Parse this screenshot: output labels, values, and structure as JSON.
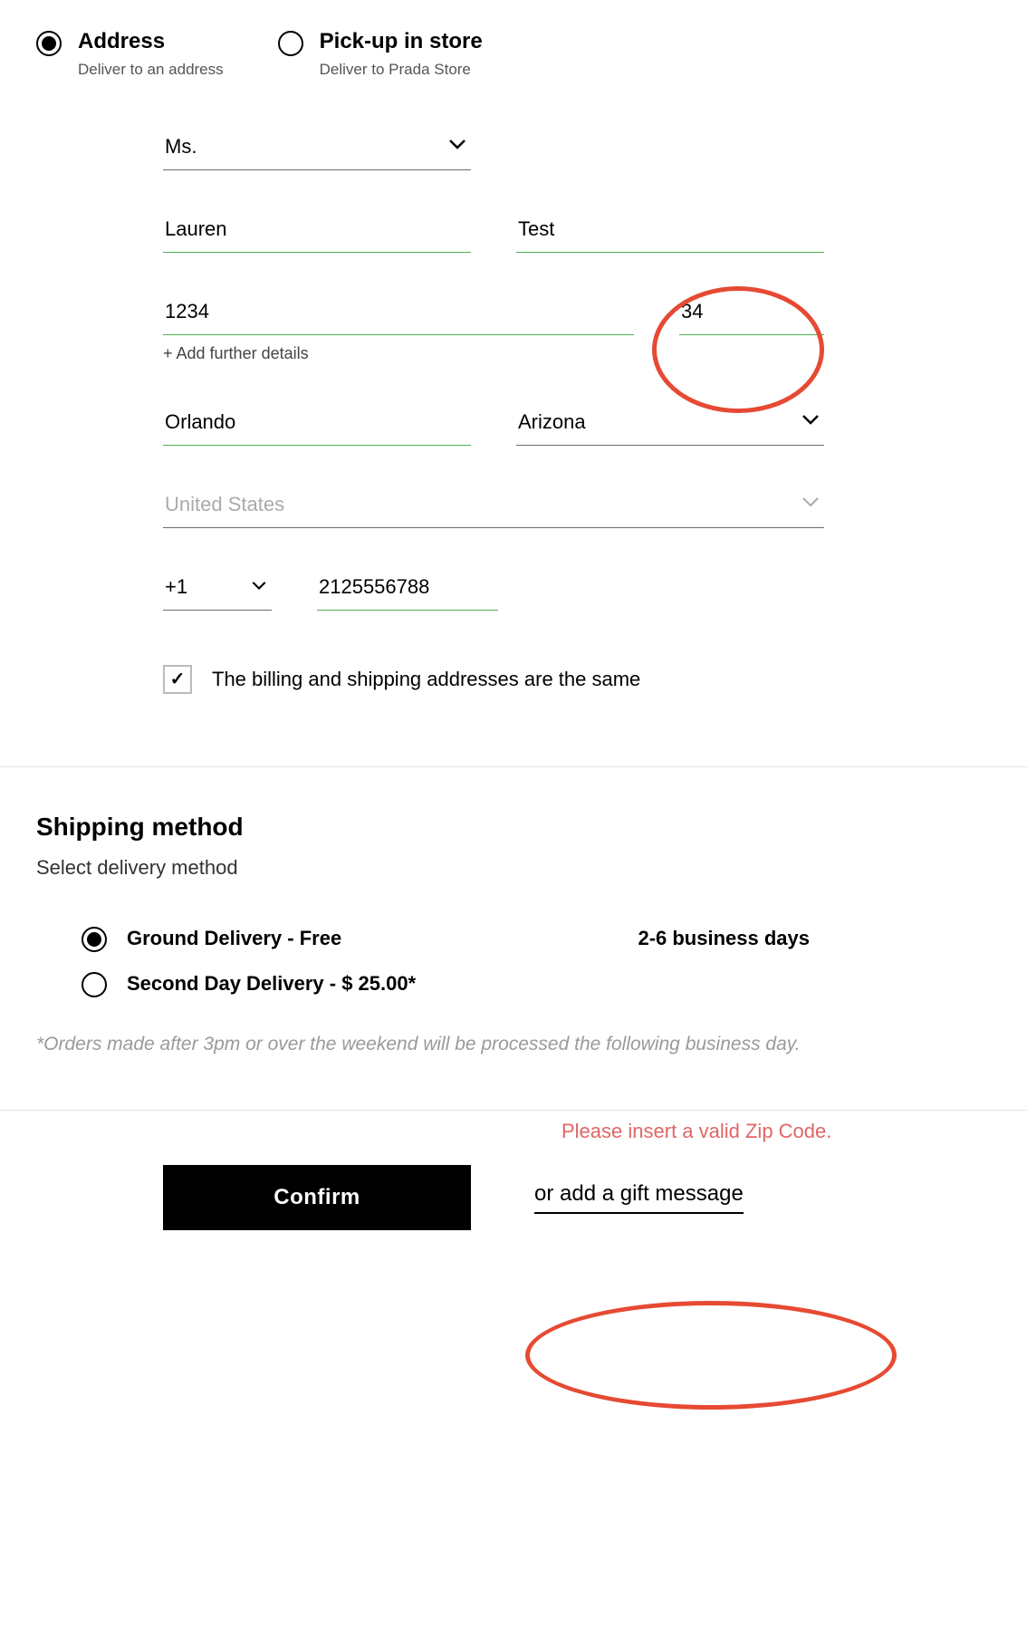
{
  "delivery": {
    "address": {
      "title": "Address",
      "sub": "Deliver to an address",
      "selected": true
    },
    "pickup": {
      "title": "Pick-up in store",
      "sub": "Deliver to Prada Store",
      "selected": false
    }
  },
  "form": {
    "title_select": "Ms.",
    "first_name": "Lauren",
    "last_name": "Test",
    "street": "1234",
    "unit": "34",
    "add_details": "+ Add further details",
    "city": "Orlando",
    "state": "Arizona",
    "country": "United States",
    "phone_prefix": "+1",
    "phone": "2125556788",
    "billing_same_label": "The billing and shipping addresses are the same",
    "billing_same_checked": "✓"
  },
  "shipping": {
    "heading": "Shipping method",
    "subtitle": "Select delivery method",
    "options": [
      {
        "label": "Ground Delivery - Free",
        "estimate": "2-6 business days",
        "selected": true
      },
      {
        "label": "Second Day Delivery - $ 25.00*",
        "estimate": "",
        "selected": false
      }
    ],
    "footnote": "*Orders made after 3pm or over the weekend will be processed the following business day."
  },
  "bottom": {
    "confirm": "Confirm",
    "gift": "or add a gift message",
    "error": "Please insert a valid Zip Code."
  }
}
